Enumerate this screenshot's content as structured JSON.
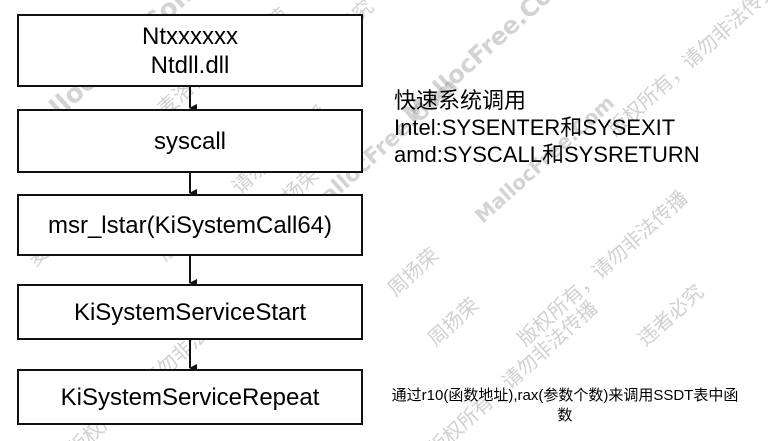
{
  "flow": {
    "box1": {
      "line1": "Ntxxxxxx",
      "line2": "Ntdll.dll"
    },
    "box2": {
      "label": "syscall"
    },
    "box3": {
      "label": "msr_lstar(KiSystemCall64)"
    },
    "box4": {
      "label": "KiSystemServiceStart"
    },
    "box5": {
      "label": "KiSystemServiceRepeat"
    }
  },
  "notes": {
    "fast": {
      "title": "快速系统调用",
      "intel": "Intel:SYSENTER和SYSEXIT",
      "amd": "amd:SYSCALL和SYSRETURN"
    },
    "ssdt": "通过r10(函数地址),rax(参数个数)来调用SSDT表中函数"
  },
  "watermarks": {
    "site": "MallocFree.Com",
    "author": "周扬荣",
    "rights": "版权所有，请勿非法传播",
    "infringe": "违者必究",
    "tech": "麦洛科菲"
  }
}
